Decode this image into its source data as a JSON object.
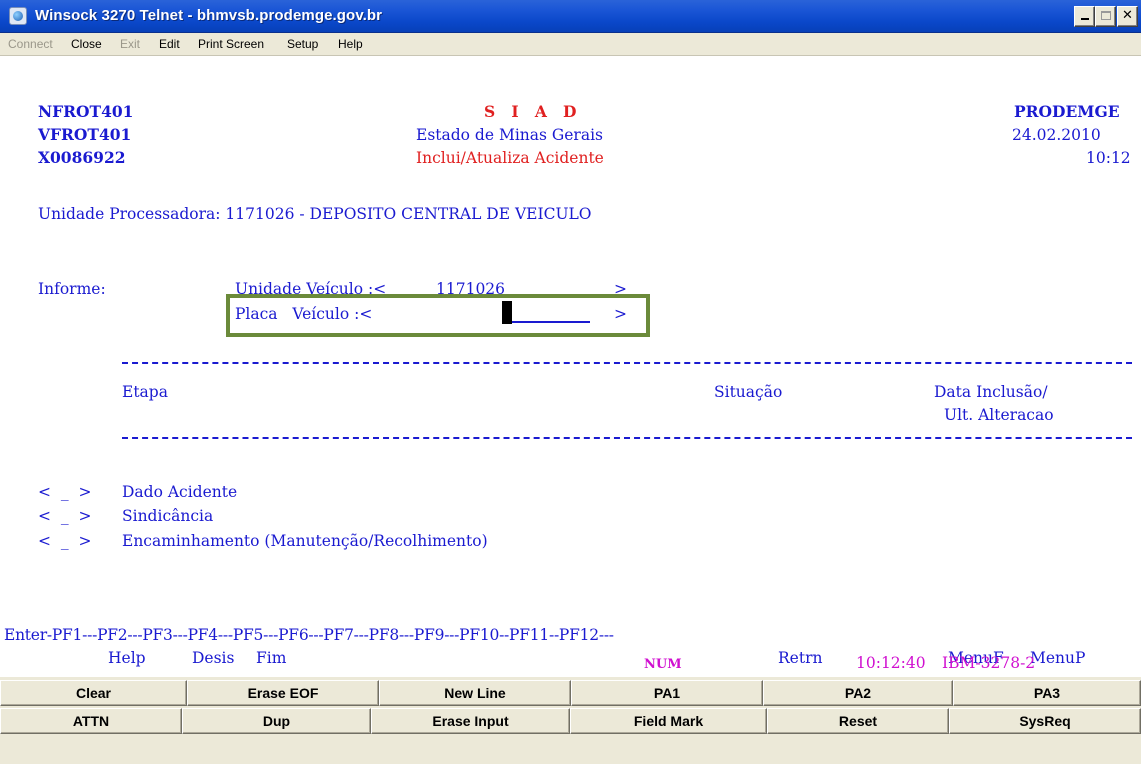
{
  "window": {
    "title": "Winsock 3270 Telnet - bhmvsb.prodemge.gov.br"
  },
  "menu": {
    "connect": "Connect",
    "close": "Close",
    "exit": "Exit",
    "edit": "Edit",
    "print_screen": "Print Screen",
    "setup": "Setup",
    "help": "Help"
  },
  "screen": {
    "program1": "NFROT401",
    "program2": "VFROT401",
    "user": "X0086922",
    "system": "S   I   A   D",
    "state": "Estado de Minas Gerais",
    "function": "Inclui/Atualiza Acidente",
    "company": "PRODEMGE",
    "date": "24.02.2010",
    "time": "10:12",
    "unidade_processadora": "Unidade Processadora: 1171026 - DEPOSITO CENTRAL DE VEICULO",
    "informe_label": "Informe:",
    "unidade_veiculo_label": "Unidade Veículo :<",
    "unidade_veiculo_value": "1171026",
    "field_close": ">",
    "placa_label": "Placa   Veículo :<",
    "placa_value": "",
    "col_etapa": "Etapa",
    "col_situacao": "Situação",
    "col_data1": "Data Inclusão/",
    "col_data2": "Ult. Alteracao",
    "options": [
      {
        "bracket": "<  _  >",
        "label": "Dado Acidente"
      },
      {
        "bracket": "<  _  >",
        "label": "Sindicância"
      },
      {
        "bracket": "<  _  >",
        "label": "Encaminhamento (Manutenção/Recolhimento)"
      }
    ],
    "pf_line": "Enter-PF1---PF2---PF3---PF4---PF5---PF6---PF7---PF8---PF9---PF10--PF11--PF12---",
    "pf_help": "Help",
    "pf_desis": "Desis",
    "pf_fim": "Fim",
    "pf_retrn": "Retrn",
    "pf_menuf": "MenuF",
    "pf_menup": "MenuP",
    "status_num": "NUM",
    "status_time": "10:12:40",
    "status_term": "IBM-3278-2"
  },
  "keypad": {
    "row1": [
      "Clear",
      "Erase EOF",
      "New Line",
      "PA1",
      "PA2",
      "PA3"
    ],
    "row2": [
      "ATTN",
      "Dup",
      "Erase Input",
      "Field Mark",
      "Reset",
      "SysReq"
    ]
  }
}
